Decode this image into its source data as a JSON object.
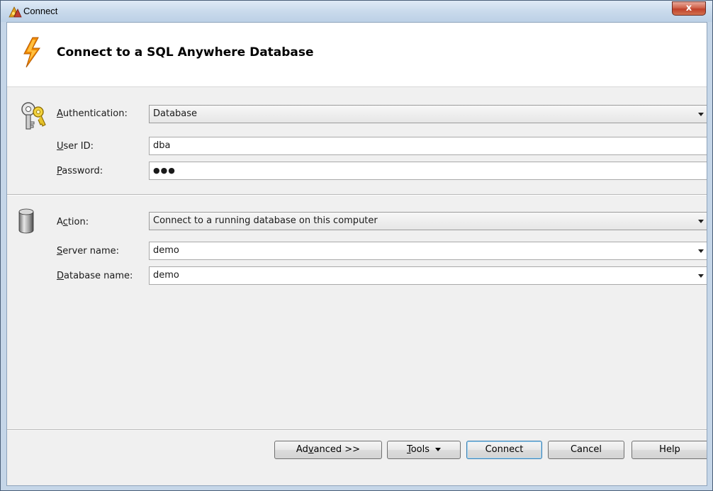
{
  "window": {
    "title": "Connect",
    "close_glyph": "x"
  },
  "header": {
    "title": "Connect to a SQL Anywhere Database",
    "icon": "lightning-bolt-icon"
  },
  "credentials": {
    "icon": "keys-icon",
    "authentication": {
      "label_prefix": "",
      "label_mnemonic": "A",
      "label_rest": "uthentication:",
      "value": "Database"
    },
    "user_id": {
      "label_mnemonic": "U",
      "label_rest": "ser ID:",
      "value": "dba"
    },
    "password": {
      "label_mnemonic": "P",
      "label_rest": "assword:",
      "value": "●●●"
    }
  },
  "connection": {
    "icon": "database-cylinder-icon",
    "action": {
      "label_prefix": "A",
      "label_mnemonic": "c",
      "label_rest": "tion:",
      "value": "Connect to a running database on this computer"
    },
    "server_name": {
      "label_mnemonic": "S",
      "label_rest": "erver name:",
      "value": "demo"
    },
    "database_name": {
      "label_mnemonic": "D",
      "label_rest": "atabase name:",
      "value": "demo"
    }
  },
  "buttons": {
    "advanced": {
      "prefix": "Ad",
      "mnemonic": "v",
      "rest": "anced >>"
    },
    "tools": {
      "mnemonic": "T",
      "rest": "ools"
    },
    "connect": "Connect",
    "cancel": "Cancel",
    "help": "Help"
  },
  "colors": {
    "titlebar": "#c9daec",
    "close_button": "#c0402a",
    "default_button_border": "#3c7fb1",
    "bolt": "#f08a00"
  }
}
